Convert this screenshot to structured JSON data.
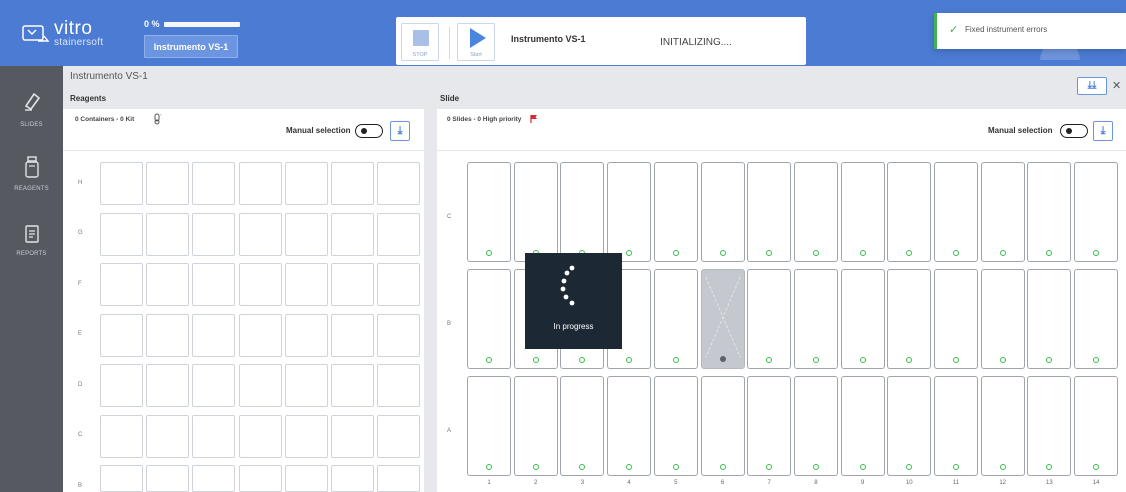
{
  "header": {
    "logo_text_main": "vitro",
    "logo_text_sub": "stainersoft",
    "progress_label": "0 %",
    "progress_value": 0,
    "instrument_button": "Instrumento VS-1"
  },
  "controls": {
    "stop_label": "STOP",
    "start_label": "Start",
    "instrument_name": "Instrumento VS-1",
    "status": "INITIALIZING...."
  },
  "toast": {
    "icon": "check-icon",
    "message": "Fixed instrument errors"
  },
  "sidebar": {
    "items": [
      {
        "label": "SLIDES",
        "icon": "eraser-icon"
      },
      {
        "label": "REAGENTS",
        "icon": "bottle-icon"
      },
      {
        "label": "REPORTS",
        "icon": "report-icon"
      }
    ]
  },
  "main": {
    "breadcrumb": "Instrumento VS-1",
    "collapse_button": "⤓⤓",
    "close_button": "✕"
  },
  "reagents": {
    "title": "Reagents",
    "counts": "0 Containers - 0 Kit",
    "manual_selection_label": "Manual selection",
    "rows": [
      "H",
      "G",
      "F",
      "E",
      "D",
      "C",
      "B"
    ]
  },
  "slides": {
    "title": "Slide",
    "counts": "0 Slides - 0 High priority",
    "manual_selection_label": "Manual selection",
    "rows": [
      "C",
      "B",
      "A"
    ],
    "columns": [
      "1",
      "2",
      "3",
      "4",
      "5",
      "6",
      "7",
      "8",
      "9",
      "10",
      "11",
      "12",
      "13",
      "14"
    ],
    "disabled_slot": {
      "row": "B",
      "column": "6"
    }
  },
  "overlay": {
    "text": "In progress"
  },
  "colors": {
    "header": "#4b7bd2",
    "sidebar": "#565a60",
    "accent": "#4a7fd6",
    "success": "#3cbc4e",
    "priority_flag": "#d9262c",
    "overlay": "#1c2935"
  }
}
